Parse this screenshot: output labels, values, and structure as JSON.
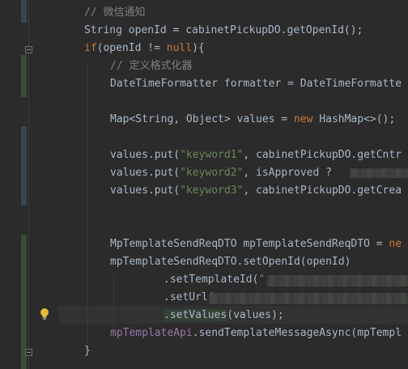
{
  "editor": {
    "lines": [
      {
        "segments": [
          {
            "t": "// 微信通知",
            "c": "cmt"
          }
        ]
      },
      {
        "segments": [
          {
            "t": "String openId = cabinetPickupDO.getOpenId();",
            "c": ""
          }
        ]
      },
      {
        "segments": [
          {
            "t": "if",
            "c": "kw"
          },
          {
            "t": "(openId != ",
            "c": ""
          },
          {
            "t": "null",
            "c": "kw"
          },
          {
            "t": "){",
            "c": ""
          }
        ]
      },
      {
        "segments": [
          {
            "t": "// 定义格式化器",
            "c": "cmt"
          }
        ]
      },
      {
        "segments": [
          {
            "t": "DateTimeFormatter formatter = DateTimeFormatte",
            "c": ""
          }
        ]
      },
      {
        "segments": [
          {
            "t": "",
            "c": ""
          }
        ]
      },
      {
        "segments": [
          {
            "t": "Map<String, Object> values = ",
            "c": ""
          },
          {
            "t": "new",
            "c": "kw"
          },
          {
            "t": " HashMap<>();",
            "c": ""
          }
        ]
      },
      {
        "segments": [
          {
            "t": "",
            "c": ""
          }
        ]
      },
      {
        "segments": [
          {
            "t": "values.put(",
            "c": ""
          },
          {
            "t": "\"keyword1\"",
            "c": "str"
          },
          {
            "t": ", cabinetPickupDO.getCntr",
            "c": ""
          }
        ]
      },
      {
        "segments": [
          {
            "t": "values.put(",
            "c": ""
          },
          {
            "t": "\"keyword2\"",
            "c": "str"
          },
          {
            "t": ", isApproved ?",
            "c": ""
          }
        ]
      },
      {
        "segments": [
          {
            "t": "values.put(",
            "c": ""
          },
          {
            "t": "\"keyword3\"",
            "c": "str"
          },
          {
            "t": ", cabinetPickupDO.getCrea",
            "c": ""
          }
        ]
      },
      {
        "segments": [
          {
            "t": "",
            "c": ""
          }
        ]
      },
      {
        "segments": [
          {
            "t": "",
            "c": ""
          }
        ]
      },
      {
        "segments": [
          {
            "t": "MpTemplateSendReqDTO mpTemplateSendReqDTO = ",
            "c": ""
          },
          {
            "t": "ne",
            "c": "kw"
          }
        ]
      },
      {
        "segments": [
          {
            "t": "mpTemplateSendReqDTO.setOpenId(openId)",
            "c": ""
          }
        ]
      },
      {
        "segments": [
          {
            "t": ".setTemplateId(",
            "c": ""
          },
          {
            "t": "\"",
            "c": "str"
          }
        ]
      },
      {
        "segments": [
          {
            "t": ".setUrl(",
            "c": ""
          }
        ]
      },
      {
        "segments": [
          {
            "t": ".setValues",
            "c": "hl"
          },
          {
            "t": "(values);",
            "c": ""
          }
        ]
      },
      {
        "segments": [
          {
            "t": "mpTemplateApi",
            "c": "fld"
          },
          {
            "t": ".sendTemplateMessageAsync(mpTempl",
            "c": ""
          }
        ]
      },
      {
        "segments": [
          {
            "t": "}",
            "c": ""
          }
        ]
      }
    ],
    "icons": {
      "bulb": "lightbulb-icon",
      "fold": "fold-icon"
    },
    "colors": {
      "background": "#2b2b2b",
      "keyword": "#cc7832",
      "string": "#6a8759",
      "comment": "#808080",
      "field": "#9876aa",
      "text": "#a9b7c6",
      "modified_marker": "#374752",
      "added_marker": "#384c38"
    }
  }
}
